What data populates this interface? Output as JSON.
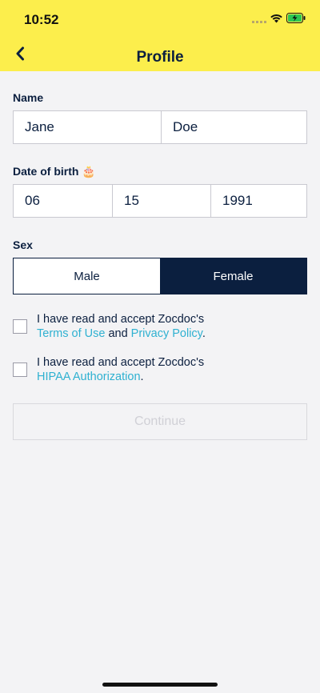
{
  "status": {
    "time": "10:52"
  },
  "header": {
    "title": "Profile",
    "back_icon": "chevron-left-icon"
  },
  "name": {
    "label": "Name",
    "first": "Jane",
    "last": "Doe"
  },
  "dob": {
    "label": "Date of birth",
    "emoji": "🎂",
    "month": "06",
    "day": "15",
    "year": "1991"
  },
  "sex": {
    "label": "Sex",
    "options": [
      "Male",
      "Female"
    ],
    "selected": "Female"
  },
  "terms": {
    "line1": "I have read and accept Zocdoc's",
    "terms_link": "Terms of Use",
    "and": " and ",
    "privacy_link": "Privacy Policy",
    "period": "."
  },
  "hipaa": {
    "line1": "I have read and accept Zocdoc's",
    "link": "HIPAA Authorization",
    "period": "."
  },
  "continue": {
    "label": "Continue",
    "enabled": false
  },
  "colors": {
    "header_bg": "#fcee4c",
    "navy": "#0b1f3f",
    "link": "#2fb1d1",
    "background": "#f3f3f5"
  }
}
